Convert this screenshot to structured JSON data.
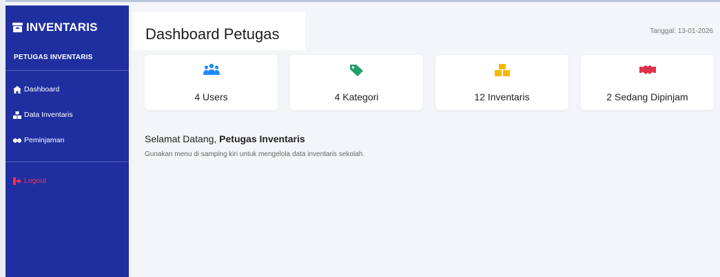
{
  "sidebar": {
    "brand": "INVENTARIS",
    "role": "PETUGAS INVENTARIS",
    "items": [
      {
        "label": "Dashboard",
        "icon": "home-icon"
      },
      {
        "label": "Data Inventaris",
        "icon": "boxes-icon"
      },
      {
        "label": "Peminjaman",
        "icon": "handshake-icon"
      }
    ],
    "logout": {
      "label": "Logout",
      "icon": "sign-out-icon"
    }
  },
  "header": {
    "title": "Dashboard Petugas",
    "date": "Tanggal: 13-01-2026"
  },
  "stats": [
    {
      "label": "4 Users",
      "icon": "users-icon",
      "color": "#1e88ff"
    },
    {
      "label": "4 Kategori",
      "icon": "tag-icon",
      "color": "#22a06b"
    },
    {
      "label": "12 Inventaris",
      "icon": "boxes-icon",
      "color": "#f5b800"
    },
    {
      "label": "2 Sedang Dipinjam",
      "icon": "handshake-icon",
      "color": "#e03048"
    }
  ],
  "welcome": {
    "prefix": "Selamat Datang, ",
    "name": "Petugas Inventaris",
    "hint": "Gunakan menu di samping kiri untuk mengelola data inventaris sekolah."
  },
  "colors": {
    "sidebar_bg": "#1f2fa0",
    "page_bg": "#f4f5f9",
    "logout": "#ff2d4a"
  }
}
